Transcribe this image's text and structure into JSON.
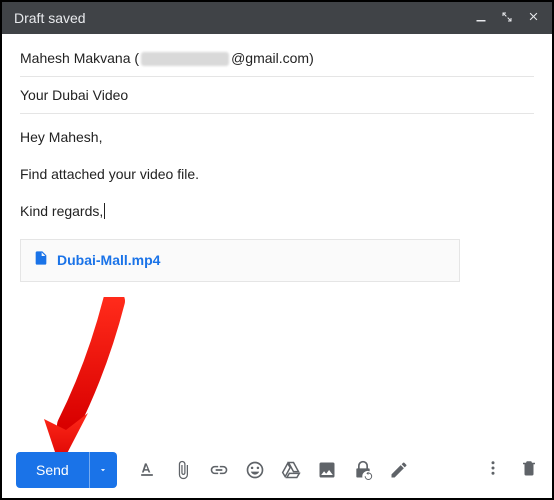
{
  "header": {
    "title": "Draft saved"
  },
  "to": {
    "name": "Mahesh Makvana",
    "domain": "@gmail.com"
  },
  "subject": "Your Dubai Video",
  "body": {
    "greeting": "Hey Mahesh,",
    "line1": "Find attached your video file.",
    "signoff": "Kind regards,"
  },
  "attachment": {
    "filename": "Dubai-Mall.mp4"
  },
  "actions": {
    "send": "Send"
  }
}
